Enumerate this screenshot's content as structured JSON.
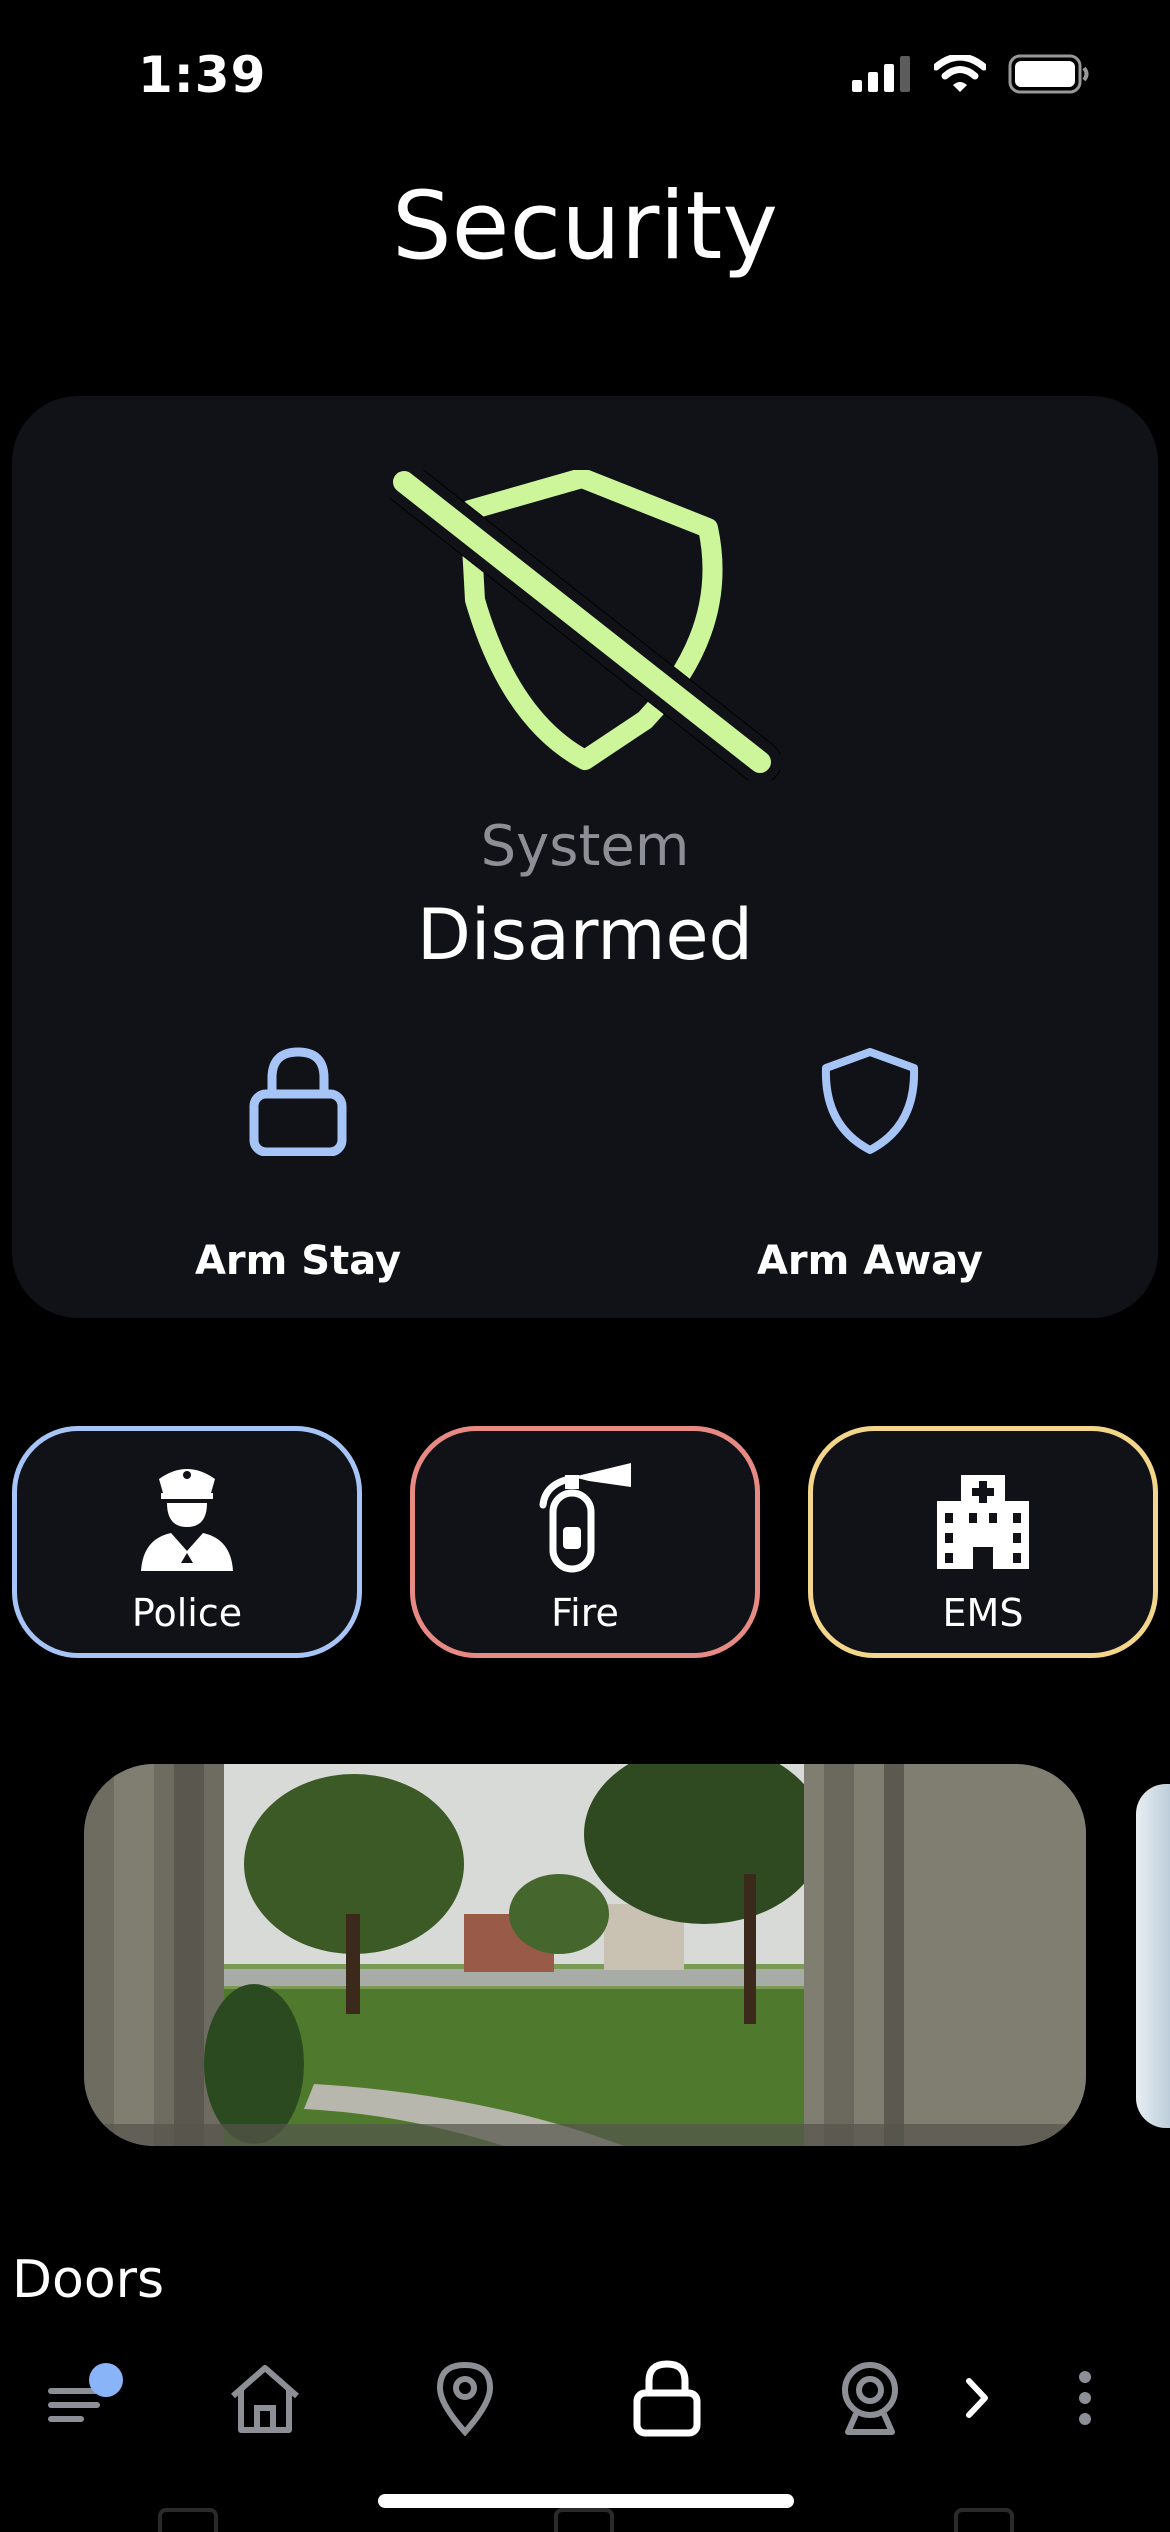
{
  "status_bar": {
    "time": "1:39",
    "icons": [
      "signal-icon",
      "wifi-icon",
      "battery-icon"
    ]
  },
  "page": {
    "title": "Security"
  },
  "system": {
    "label": "System",
    "state": "Disarmed",
    "icon": "shield-off-icon",
    "state_color": "#cdf59a"
  },
  "arm_actions": [
    {
      "label": "Arm Stay",
      "icon": "lock-icon"
    },
    {
      "label": "Arm Away",
      "icon": "shield-icon"
    }
  ],
  "emergency": [
    {
      "label": "Police",
      "icon": "police-officer-icon",
      "border_color": "#a6c4f5"
    },
    {
      "label": "Fire",
      "icon": "fire-extinguisher-icon",
      "border_color": "#e88a84"
    },
    {
      "label": "EMS",
      "icon": "hospital-icon",
      "border_color": "#f3d68a"
    }
  ],
  "camera": {
    "icon": "camera-feed"
  },
  "sections": {
    "doors": "Doors"
  },
  "nav": {
    "items": [
      "menu-icon",
      "home-icon",
      "location-pin-icon",
      "lock-icon",
      "webcam-icon",
      "chevron-right-icon",
      "more-vertical-icon"
    ],
    "active": "lock-icon",
    "badge_color": "#8ab4f8"
  },
  "colors": {
    "accent_blue": "#a6c4f5",
    "accent_green": "#cdf59a",
    "card_bg": "#111217"
  }
}
